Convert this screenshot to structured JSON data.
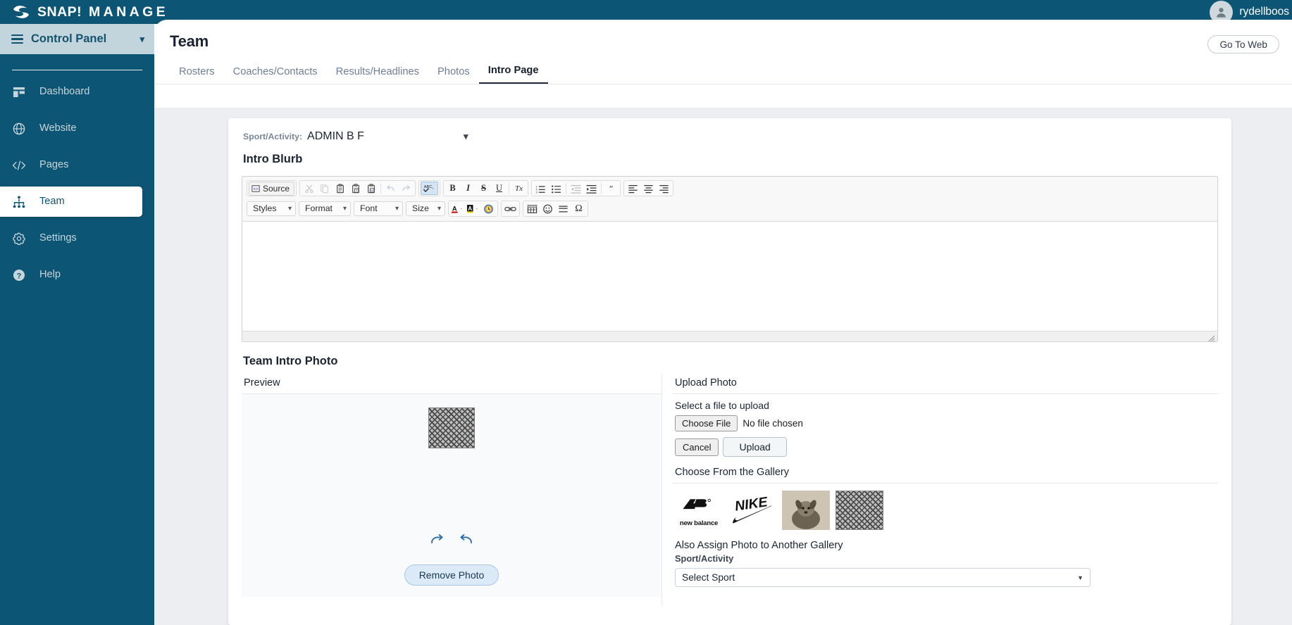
{
  "brand": {
    "name_bold": "SNAP!",
    "name_spaced": "MANAGE",
    "logo_icon": "snap-logo-icon"
  },
  "topbar": {
    "user_name": "rydellboos",
    "avatar_icon": "user-avatar-icon"
  },
  "sidebar": {
    "control_panel_label": "Control Panel",
    "menu_icon": "hamburger-icon",
    "chevron_icon": "chevron-down-icon",
    "items": [
      {
        "label": "Dashboard",
        "icon": "dashboard-icon",
        "active": false
      },
      {
        "label": "Website",
        "icon": "globe-icon",
        "active": false
      },
      {
        "label": "Pages",
        "icon": "code-icon",
        "active": false
      },
      {
        "label": "Team",
        "icon": "org-chart-icon",
        "active": true
      },
      {
        "label": "Settings",
        "icon": "gear-icon",
        "active": false
      },
      {
        "label": "Help",
        "icon": "question-circle-icon",
        "active": false
      }
    ]
  },
  "header": {
    "page_title": "Team",
    "go_to_web_label": "Go To Web"
  },
  "tabs": [
    {
      "label": "Rosters",
      "active": false
    },
    {
      "label": "Coaches/Contacts",
      "active": false
    },
    {
      "label": "Results/Headlines",
      "active": false
    },
    {
      "label": "Photos",
      "active": false
    },
    {
      "label": "Intro Page",
      "active": true
    }
  ],
  "sport": {
    "label": "Sport/Activity:",
    "value": "ADMIN B F",
    "caret_icon": "chevron-down-icon"
  },
  "intro_blurb": {
    "title": "Intro Blurb",
    "editor_content": "",
    "toolbar_row1": [
      {
        "name": "source-button",
        "label": "Source",
        "icon": "source-code-icon",
        "state": "normal"
      },
      {
        "name": "cut-button",
        "label": "",
        "icon": "scissors-icon",
        "state": "disabled"
      },
      {
        "name": "copy-button",
        "label": "",
        "icon": "copy-icon",
        "state": "disabled"
      },
      {
        "name": "paste-button",
        "label": "",
        "icon": "clipboard-icon",
        "state": "normal"
      },
      {
        "name": "paste-text-button",
        "label": "",
        "icon": "clipboard-text-icon",
        "state": "normal"
      },
      {
        "name": "paste-word-button",
        "label": "",
        "icon": "clipboard-word-icon",
        "state": "normal"
      },
      {
        "name": "undo-button",
        "label": "",
        "icon": "undo-arrow-icon",
        "state": "disabled"
      },
      {
        "name": "redo-button",
        "label": "",
        "icon": "redo-arrow-icon",
        "state": "disabled"
      },
      {
        "name": "spellcheck-button",
        "label": "",
        "icon": "spellcheck-abc-icon",
        "state": "selected"
      },
      {
        "name": "bold-button",
        "label": "B",
        "icon": "bold-icon",
        "state": "normal"
      },
      {
        "name": "italic-button",
        "label": "I",
        "icon": "italic-icon",
        "state": "normal"
      },
      {
        "name": "strike-button",
        "label": "S",
        "icon": "strikethrough-icon",
        "state": "normal"
      },
      {
        "name": "underline-button",
        "label": "U",
        "icon": "underline-icon",
        "state": "normal"
      },
      {
        "name": "remove-format-button",
        "label": "Tx",
        "icon": "remove-format-icon",
        "state": "normal"
      },
      {
        "name": "numbered-list-button",
        "label": "",
        "icon": "numbered-list-icon",
        "state": "normal"
      },
      {
        "name": "bulleted-list-button",
        "label": "",
        "icon": "bulleted-list-icon",
        "state": "normal"
      },
      {
        "name": "outdent-button",
        "label": "",
        "icon": "outdent-icon",
        "state": "disabled"
      },
      {
        "name": "indent-button",
        "label": "",
        "icon": "indent-icon",
        "state": "normal"
      },
      {
        "name": "blockquote-button",
        "label": "",
        "icon": "blockquote-icon",
        "state": "normal"
      },
      {
        "name": "align-left-button",
        "label": "",
        "icon": "align-left-icon",
        "state": "normal"
      },
      {
        "name": "align-center-button",
        "label": "",
        "icon": "align-center-icon",
        "state": "normal"
      },
      {
        "name": "align-right-button",
        "label": "",
        "icon": "align-right-icon",
        "state": "normal"
      }
    ],
    "toolbar_row2": {
      "styles_label": "Styles",
      "format_label": "Format",
      "font_label": "Font",
      "size_label": "Size",
      "text_color_icon": "text-color-icon",
      "bg_color_icon": "background-color-icon",
      "maximize_icon": "maximize-icon",
      "link_icon": "link-icon",
      "table_icon": "table-icon",
      "smiley_icon": "smiley-icon",
      "horizontal_rule_icon": "horizontal-rule-icon",
      "special_char_label": "Ω",
      "special_char_icon": "omega-special-character-icon"
    }
  },
  "team_intro_photo": {
    "title": "Team Intro Photo",
    "preview": {
      "heading": "Preview",
      "image_alt": "pattern-thumbnail",
      "rotate_right_icon": "rotate-right-icon",
      "rotate_left_icon": "rotate-left-icon",
      "remove_label": "Remove Photo"
    },
    "upload": {
      "heading": "Upload Photo",
      "select_file_label": "Select a file to upload",
      "choose_file_label": "Choose File",
      "no_file_label": "No file chosen",
      "cancel_label": "Cancel",
      "upload_label": "Upload",
      "gallery_heading": "Choose From the Gallery",
      "gallery_items": [
        {
          "name": "new-balance-logo",
          "type": "newbalance",
          "caption": "new balance"
        },
        {
          "name": "nike-logo",
          "type": "nike",
          "caption": ""
        },
        {
          "name": "dog-photo",
          "type": "photo",
          "caption": ""
        },
        {
          "name": "pattern-image",
          "type": "pattern",
          "caption": ""
        }
      ],
      "assign_title": "Also Assign Photo to Another Gallery",
      "assign_sub_label": "Sport/Activity",
      "select_sport_value": "Select Sport",
      "select_caret_icon": "chevron-down-icon"
    }
  },
  "colors": {
    "brand_teal": "#0d5574",
    "sidebar_header": "#c2d4dc",
    "content_bg": "#eceef1",
    "accent_button": "#dce9f6"
  }
}
